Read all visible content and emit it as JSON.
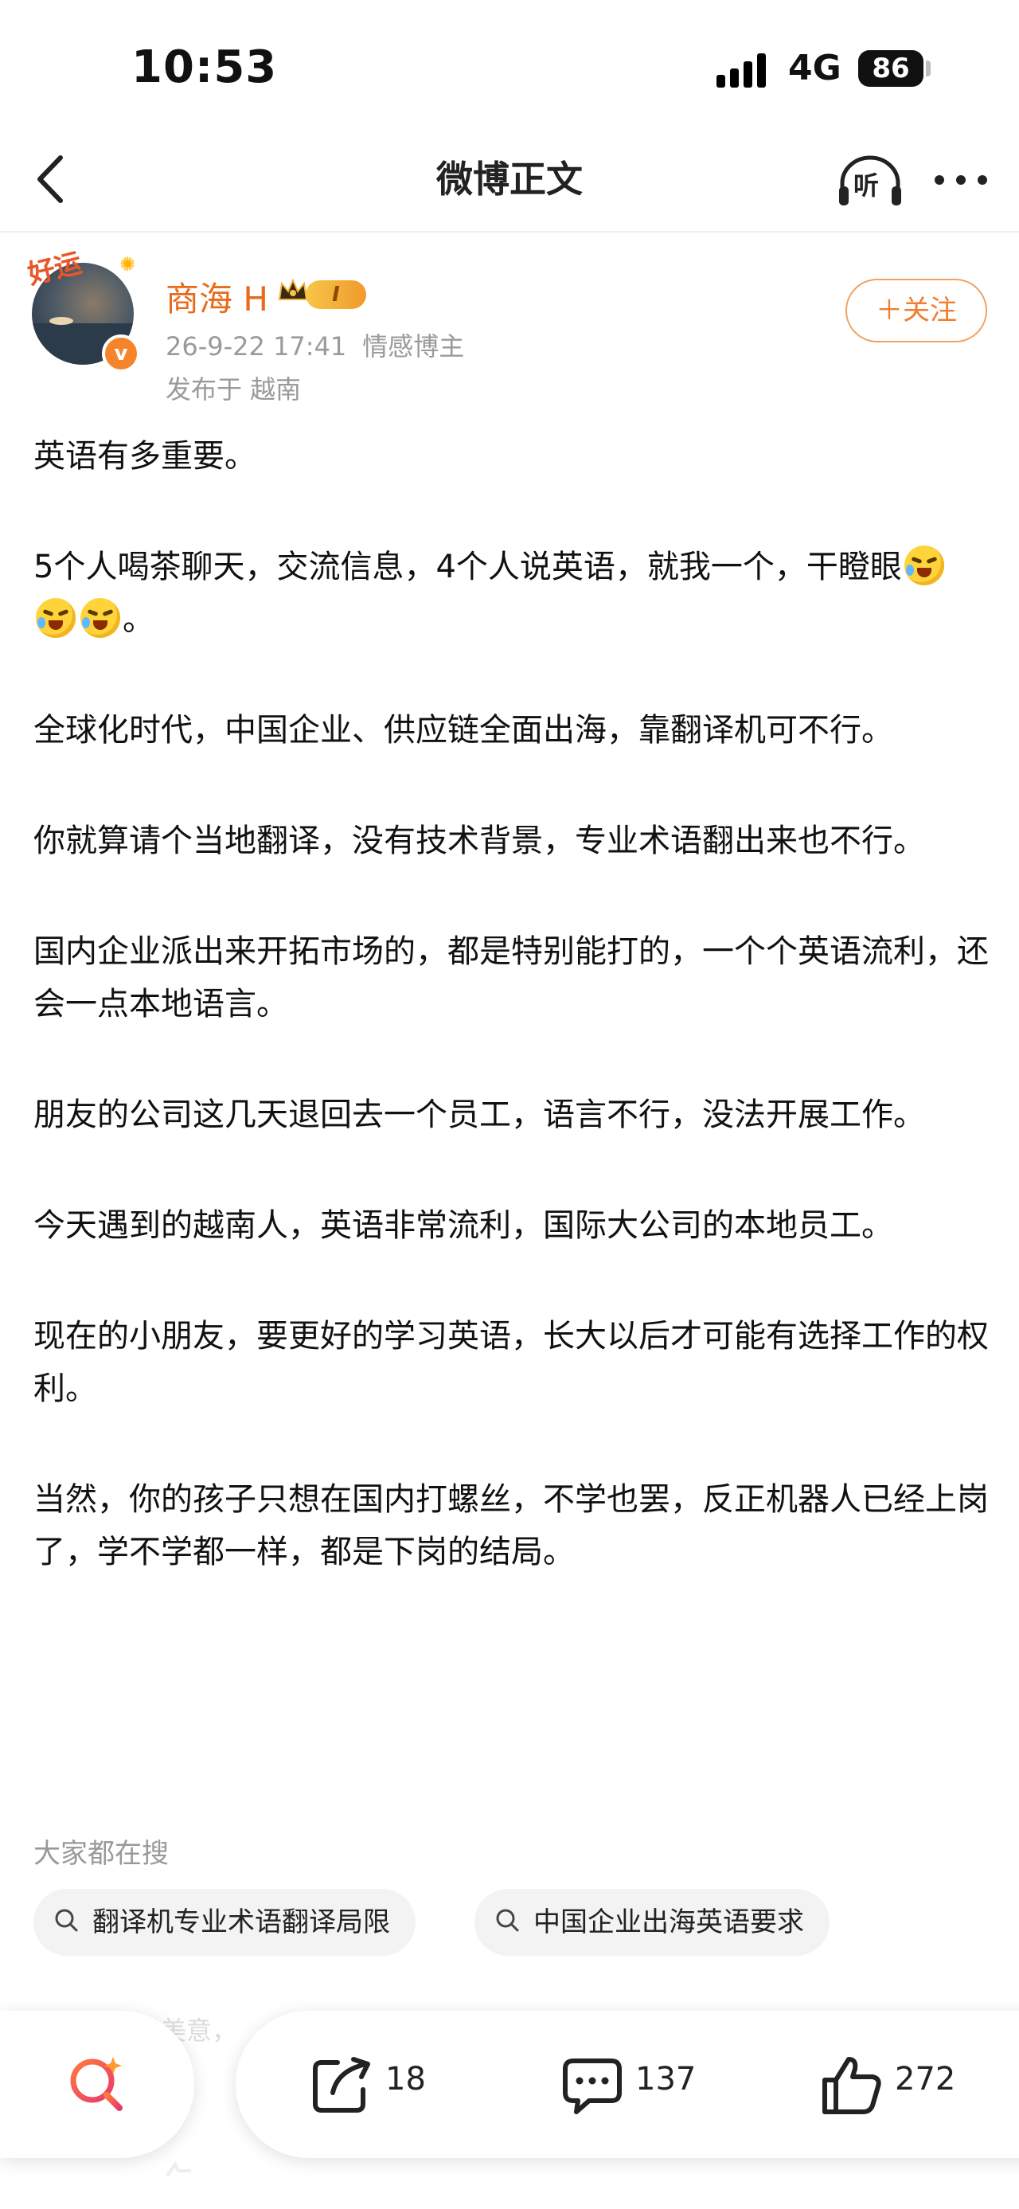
{
  "status_bar": {
    "time": "10:53",
    "network": "4G",
    "battery": "86"
  },
  "nav": {
    "title": "微博正文",
    "listen_label": "听"
  },
  "author": {
    "name": "商海 H",
    "level": "I",
    "avatar_frame_text": "好运",
    "verified_mark": "v",
    "date": "26-9-22 17:41",
    "tag": "情感博主",
    "location": "发布于 越南",
    "follow_label": "＋关注"
  },
  "post": {
    "paragraphs": [
      "英语有多重要。",
      "5个人喝茶聊天，交流信息，4个人说英语，就我一个，干瞪眼",
      "全球化时代，中国企业、供应链全面出海，靠翻译机可不行。",
      "你就算请个当地翻译，没有技术背景，专业术语翻出来也不行。",
      "国内企业派出来开拓市场的，都是特别能打的，一个个英语流利，还会一点本地语言。",
      "朋友的公司这几天退回去一个员工，语言不行，没法开展工作。",
      "今天遇到的越南人，英语非常流利，国际大公司的本地员工。",
      "现在的小朋友，要更好的学习英语，长大以后才可能有选择工作的权利。",
      "当然，你的孩子只想在国内打螺丝，不学也罢，反正机器人已经上岗了，学不学都一样，都是下岗的结局。"
    ],
    "paragraph_2_end": "。"
  },
  "search": {
    "heading": "大家都在搜",
    "chips": [
      "翻译机专业术语翻译局限",
      "中国企业出海英语要求"
    ]
  },
  "bottom": {
    "faded_text": "是美意，",
    "repost_count": "18",
    "comment_count": "137",
    "like_count": "272"
  },
  "colors": {
    "accent": "#f07e2c",
    "name": "#e86a1a",
    "meta": "#9a9a9a"
  }
}
